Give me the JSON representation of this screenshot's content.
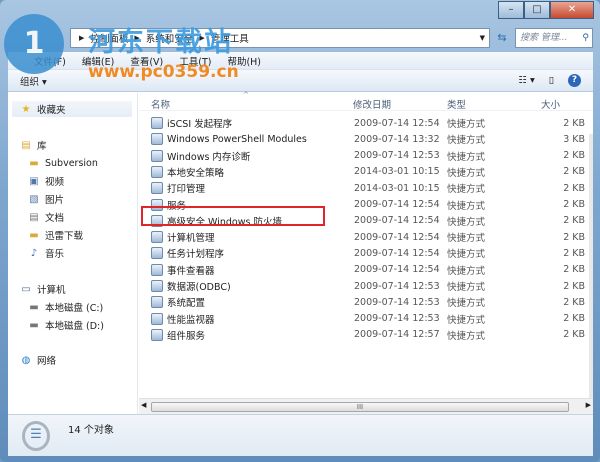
{
  "window": {
    "minimize": "–",
    "maximize": "□",
    "close": "✕"
  },
  "address": {
    "crumbs": [
      "控制面板",
      "系统和安全",
      "管理工具"
    ],
    "search_placeholder": "搜索 管理..."
  },
  "menu": [
    "文件(F)",
    "编辑(E)",
    "查看(V)",
    "工具(T)",
    "帮助(H)"
  ],
  "toolbar": {
    "organize": "组织 ▾",
    "help": "?"
  },
  "sidebar": {
    "favorites": "收藏夹",
    "library": "库",
    "libs": [
      "Subversion",
      "视频",
      "图片",
      "文档",
      "迅雷下载",
      "音乐"
    ],
    "computer": "计算机",
    "drives": [
      "本地磁盘 (C:)",
      "本地磁盘 (D:)"
    ],
    "network": "网络"
  },
  "columns": {
    "name": "名称",
    "date": "修改日期",
    "type": "类型",
    "size": "大小"
  },
  "files": [
    {
      "name": "iSCSI 发起程序",
      "date": "2009-07-14 12:54",
      "type": "快捷方式",
      "size": "2 KB"
    },
    {
      "name": "Windows PowerShell Modules",
      "date": "2009-07-14 13:32",
      "type": "快捷方式",
      "size": "3 KB"
    },
    {
      "name": "Windows 内存诊断",
      "date": "2009-07-14 12:53",
      "type": "快捷方式",
      "size": "2 KB"
    },
    {
      "name": "本地安全策略",
      "date": "2014-03-01 10:15",
      "type": "快捷方式",
      "size": "2 KB"
    },
    {
      "name": "打印管理",
      "date": "2014-03-01 10:15",
      "type": "快捷方式",
      "size": "2 KB"
    },
    {
      "name": "服务",
      "date": "2009-07-14 12:54",
      "type": "快捷方式",
      "size": "2 KB"
    },
    {
      "name": "高级安全 Windows 防火墙",
      "date": "2009-07-14 12:54",
      "type": "快捷方式",
      "size": "2 KB"
    },
    {
      "name": "计算机管理",
      "date": "2009-07-14 12:54",
      "type": "快捷方式",
      "size": "2 KB"
    },
    {
      "name": "任务计划程序",
      "date": "2009-07-14 12:54",
      "type": "快捷方式",
      "size": "2 KB"
    },
    {
      "name": "事件查看器",
      "date": "2009-07-14 12:54",
      "type": "快捷方式",
      "size": "2 KB"
    },
    {
      "name": "数据源(ODBC)",
      "date": "2009-07-14 12:53",
      "type": "快捷方式",
      "size": "2 KB"
    },
    {
      "name": "系统配置",
      "date": "2009-07-14 12:53",
      "type": "快捷方式",
      "size": "2 KB"
    },
    {
      "name": "性能监视器",
      "date": "2009-07-14 12:53",
      "type": "快捷方式",
      "size": "2 KB"
    },
    {
      "name": "组件服务",
      "date": "2009-07-14 12:57",
      "type": "快捷方式",
      "size": "2 KB"
    }
  ],
  "status": {
    "count": "14 个对象"
  },
  "watermark": {
    "site_name": "河东下载站",
    "url": "www.pc0359.cn"
  },
  "colors": {
    "highlight": "#e0262a"
  }
}
